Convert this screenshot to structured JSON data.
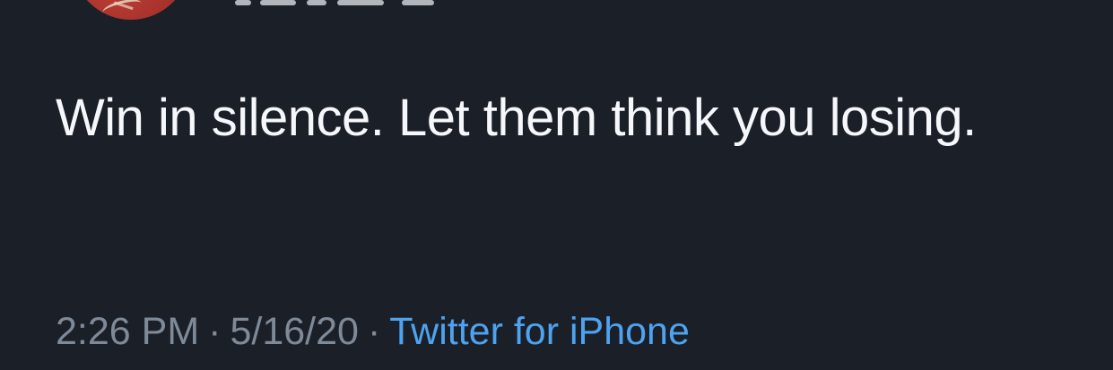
{
  "tweet": {
    "text": "Win in silence. Let them think you losing.",
    "time": "2:26 PM",
    "date": "5/16/20",
    "separator": "·",
    "source": "Twitter for iPhone"
  },
  "colors": {
    "background": "#1b1f28",
    "text": "#f5f7fa",
    "meta_text": "#7f8a99",
    "link": "#4da3f0"
  }
}
